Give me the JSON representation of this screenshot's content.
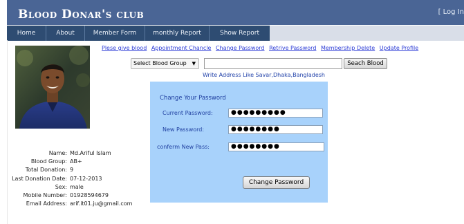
{
  "header": {
    "title": "Blood Donar's club",
    "login_link": "[ Log In"
  },
  "menu": [
    {
      "label": "Home"
    },
    {
      "label": "About"
    },
    {
      "label": "Member Form"
    },
    {
      "label": "monthly Report"
    },
    {
      "label": "Show Report"
    }
  ],
  "top_links": [
    {
      "label": "Plese give blood"
    },
    {
      "label": "Appointment Chancle"
    },
    {
      "label": "Change Password"
    },
    {
      "label": "Retrive Password"
    },
    {
      "label": "Membership Delete"
    },
    {
      "label": "Update Profile"
    }
  ],
  "search": {
    "blood_group_select": "Select Blood Group",
    "address_value": "",
    "button_label": "Seach Blood",
    "hint": "Write Address Like Savar,Dhaka,Bangladesh"
  },
  "change_password": {
    "title": "Change Your Password",
    "current_label": "Current Password:",
    "current_value": "●●●●●●●●●",
    "new_label": "New Password:",
    "new_value": "●●●●●●●●",
    "confirm_label": "conferm New Pass:",
    "confirm_value": "●●●●●●●●",
    "button_label": "Change Password"
  },
  "profile": {
    "rows": [
      {
        "label": "Name:",
        "value": "Md.Ariful Islam"
      },
      {
        "label": "Blood Group:",
        "value": "AB+"
      },
      {
        "label": "Total Donation:",
        "value": "9"
      },
      {
        "label": "Last Donation Date:",
        "value": "07-12-2013"
      },
      {
        "label": "Sex:",
        "value": "male"
      },
      {
        "label": "Mobile Number:",
        "value": "01928594679"
      },
      {
        "label": "Email Address:",
        "value": "arif.it01.ju@gmail.com"
      }
    ]
  },
  "colors": {
    "header_bg": "#4a6595",
    "menu_bg": "#2e4c72",
    "panel_bg": "#a8d2fb",
    "link": "#2b3bd6"
  }
}
